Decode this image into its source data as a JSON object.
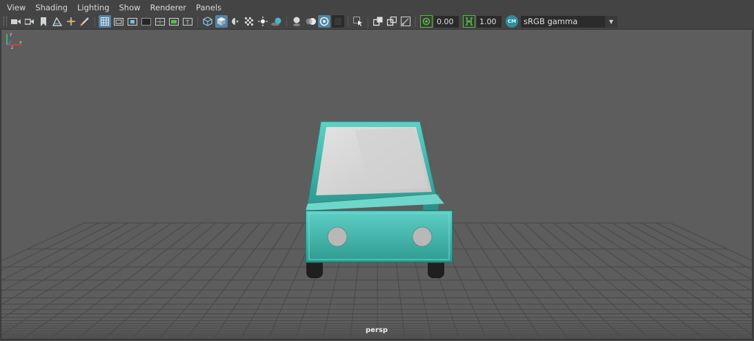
{
  "menu": [
    "View",
    "Shading",
    "Lighting",
    "Show",
    "Renderer",
    "Panels"
  ],
  "toolbar": {
    "exposure_value": "0.00",
    "gamma_value": "1.00",
    "color_space": "sRGB gamma",
    "color_mgmt_label": "CM"
  },
  "viewport": {
    "camera_name": "persp"
  },
  "colors": {
    "panel": "#444444",
    "viewport_bg": "#5d5d5d",
    "highlight": "#5285a6",
    "car_teal": "#3fb1a6",
    "green_accent": "#56c23c"
  },
  "icons": [
    "select-camera-icon",
    "camera-attributes-icon",
    "bookmark-icon",
    "image-plane-icon",
    "2d-pan-zoom-icon",
    "grease-pencil-icon",
    "grid-icon",
    "film-gate-icon",
    "resolution-gate-icon",
    "gate-mask-icon",
    "field-chart-icon",
    "safe-action-icon",
    "safe-title-icon",
    "wireframe-icon",
    "smooth-shade-icon",
    "default-material-icon",
    "textured-icon",
    "use-all-lights-icon",
    "shadows-icon",
    "screen-space-ao-icon",
    "motion-blur-icon",
    "multisample-aa-icon",
    "depth-of-field-icon",
    "isolate-select-icon",
    "xray-icon",
    "xray-active-components-icon",
    "xray-joints-icon",
    "exposure-icon",
    "gamma-icon",
    "color-management-icon"
  ]
}
